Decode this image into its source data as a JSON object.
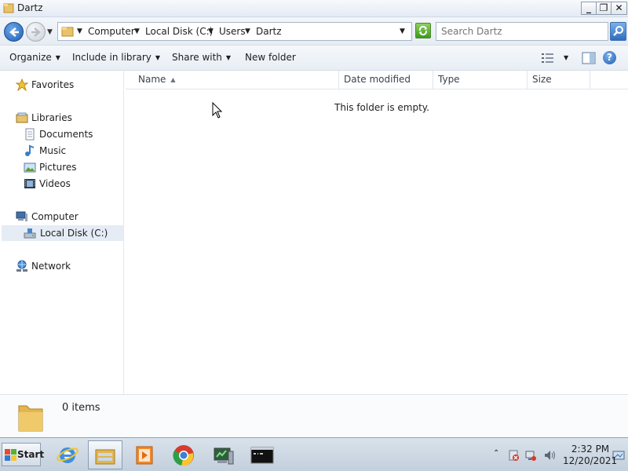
{
  "window": {
    "title": "Dartz",
    "controls": {
      "minimize": "_",
      "maximize": "❐",
      "close": "✕"
    }
  },
  "address": {
    "breadcrumbs": [
      "Computer",
      "Local Disk (C:)",
      "Users",
      "Dartz"
    ],
    "search_placeholder": "Search Dartz"
  },
  "toolbar": {
    "organize": "Organize",
    "include_in_library": "Include in library",
    "share_with": "Share with",
    "new_folder": "New folder",
    "help": "?"
  },
  "sidebar": {
    "favorites": "Favorites",
    "libraries": "Libraries",
    "library_items": [
      "Documents",
      "Music",
      "Pictures",
      "Videos"
    ],
    "computer": "Computer",
    "computer_items": [
      "Local Disk (C:)"
    ],
    "network": "Network",
    "selected": "Local Disk (C:)"
  },
  "columns": {
    "name": "Name",
    "date_modified": "Date modified",
    "type": "Type",
    "size": "Size",
    "sorted_by": "Name"
  },
  "main": {
    "empty_message": "This folder is empty."
  },
  "details": {
    "count": "0 items"
  },
  "taskbar": {
    "start": "Start",
    "apps": [
      "internet-explorer",
      "windows-explorer",
      "media-player",
      "chrome",
      "server-manager",
      "command-prompt"
    ],
    "active_app": "windows-explorer"
  },
  "tray": {
    "time": "2:32 PM",
    "date": "12/20/2021"
  }
}
